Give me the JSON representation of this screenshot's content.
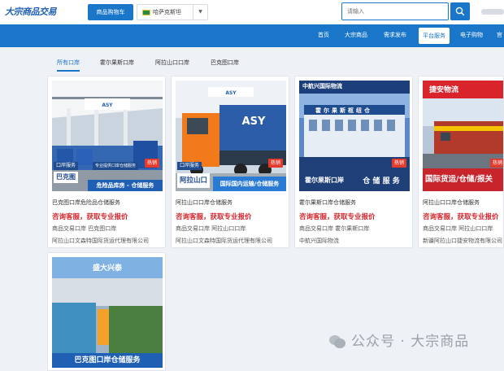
{
  "header": {
    "logo_text": "大宗商品交易",
    "logo_sub": "",
    "cart_button": "商品购物车",
    "country": "哈萨克斯坦",
    "search": {
      "placeholder": "请输入"
    }
  },
  "nav": {
    "items": [
      "首页",
      "大宗商品",
      "需求发布",
      "平台服务",
      "电子购物",
      "官"
    ],
    "active_index": 3
  },
  "tabs": {
    "items": [
      "所有口岸",
      "霍尔果斯口岸",
      "阿拉山口口岸",
      "巴克图口岸"
    ],
    "active_index": 0
  },
  "cards": [
    {
      "title": "巴克图口岸危险品仓储服务",
      "cta": "咨询客服，获取专业报价",
      "category": "商品交易口岸  巴克图口岸",
      "company": "阿拉山口文森特国际货运代理有限公司",
      "img": {
        "hot": "热销",
        "tag": "口岸服务",
        "chip": "巴克图",
        "caption": "专业提供口岸仓储服务",
        "banner": "危险品库房 - 仓储服务"
      }
    },
    {
      "title": "阿拉山口口岸仓储服务",
      "cta": "咨询客服，获取专业报价",
      "category": "商品交易口岸  阿拉山口口岸",
      "company": "阿拉山口文森特国际货运代理有限公司",
      "img": {
        "hot": "热销",
        "tag": "口岸服务",
        "chip": "阿拉山口",
        "banner": "国际国内运输/仓储服务"
      }
    },
    {
      "title": "霍尔果斯口岸仓储服务",
      "cta": "咨询客服，获取专业报价",
      "category": "商品交易口岸  霍尔果斯口岸",
      "company": "中航兴国际物流",
      "img": {
        "hot": "热销",
        "header": "中航兴国际物流",
        "building": "霍尔果斯枢纽仓",
        "chip": "霍尔果斯口岸",
        "banner": "仓 储 服 务"
      }
    },
    {
      "title": "阿拉山口口岸仓储服务",
      "cta": "咨询客服，获取专业报价",
      "category": "商品交易口岸  阿拉山口口岸",
      "company": "新疆阿拉山口捷安物流有限公司",
      "img": {
        "hot": "热销",
        "header": "捷安物流",
        "banner": "国际货运/仓储/报关"
      }
    },
    {
      "title": "",
      "cta": "",
      "category": "",
      "company": "",
      "img": {
        "header": "盛大兴泰",
        "banner": "巴克图口岸仓储服务"
      }
    }
  ],
  "watermark": {
    "text": "公众号 · 大宗商品"
  },
  "colors": {
    "brand": "#1976c9",
    "cta": "#d6262d",
    "hot": "#e23b2d"
  }
}
